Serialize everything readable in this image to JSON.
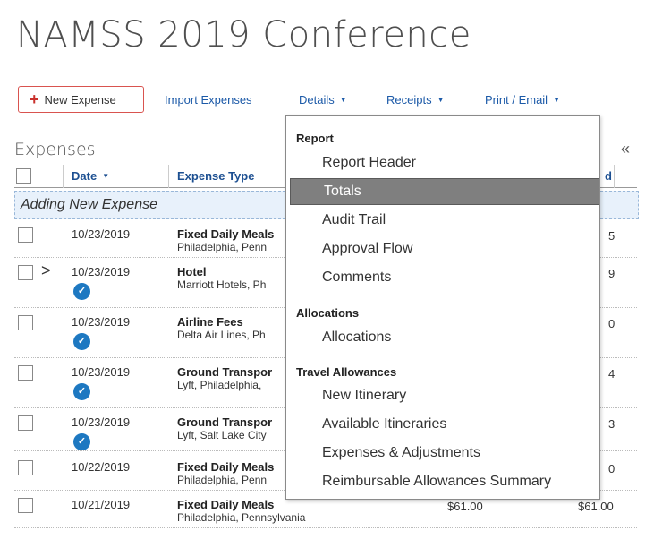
{
  "page": {
    "title": "NAMSS 2019 Conference"
  },
  "toolbar": {
    "new_expense": "New Expense",
    "import_expenses": "Import Expenses",
    "details": "Details",
    "receipts": "Receipts",
    "print_email": "Print / Email"
  },
  "expenses": {
    "title": "Expenses",
    "columns": {
      "date": "Date",
      "expense_type": "Expense Type",
      "last": "d"
    },
    "adding_row": "Adding New Expense",
    "rows": [
      {
        "date": "10/23/2019",
        "type": "Fixed Daily Meals",
        "sub": "Philadelphia, Penn",
        "amount": "5"
      },
      {
        "date": "10/23/2019",
        "type": "Hotel",
        "sub": "Marriott Hotels, Ph",
        "amount": "9"
      },
      {
        "date": "10/23/2019",
        "type": "Airline Fees",
        "sub": "Delta Air Lines, Ph",
        "amount": "0"
      },
      {
        "date": "10/23/2019",
        "type": "Ground Transpor",
        "sub": "Lyft, Philadelphia,",
        "amount": "4"
      },
      {
        "date": "10/23/2019",
        "type": "Ground Transpor",
        "sub": "Lyft, Salt Lake City",
        "amount": "3"
      },
      {
        "date": "10/22/2019",
        "type": "Fixed Daily Meals",
        "sub": "Philadelphia, Penn",
        "amount": "0"
      },
      {
        "date": "10/21/2019",
        "type": "Fixed Daily Meals",
        "sub": "Philadelphia, Pennsylvania",
        "amount_a": "$61.00",
        "amount_b": "$61.00"
      }
    ]
  },
  "details_menu": {
    "report_label": "Report",
    "report_items": [
      "Report Header",
      "Totals",
      "Audit Trail",
      "Approval Flow",
      "Comments"
    ],
    "allocations_label": "Allocations",
    "allocations_items": [
      "Allocations"
    ],
    "travel_label": "Travel Allowances",
    "travel_items": [
      "New Itinerary",
      "Available Itineraries",
      "Expenses & Adjustments",
      "Reimbursable Allowances Summary"
    ],
    "selected": "Totals"
  },
  "colors": {
    "accent_red": "#d9534f",
    "link_blue": "#1c5aa8",
    "highlight_gray": "#7f7f7f",
    "receipt_blue": "#1d78c1"
  },
  "icons": {
    "collapse": "double-chevron-left-icon",
    "receipt": "receipt-icon",
    "expand": "chevron-right-icon"
  }
}
